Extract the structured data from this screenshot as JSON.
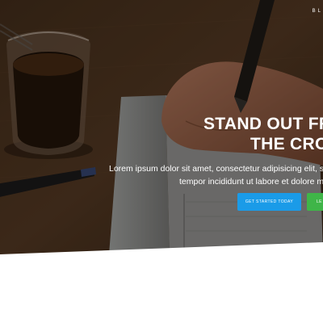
{
  "nav": {
    "brand_partial": "BL"
  },
  "hero": {
    "title_line1": "STAND OUT FR",
    "title_line2": "THE CRO",
    "subtitle_line1": "Lorem ipsum dolor sit amet, consectetur adipisicing elit, sed do",
    "subtitle_line2": "tempor incididunt ut labore et dolore mag",
    "primary_button": "GET STARTED TODAY",
    "secondary_button": "LE"
  },
  "colors": {
    "primary_button": "#1a9be8",
    "secondary_button": "#3fb548",
    "hero_overlay": "#2b1d15"
  }
}
